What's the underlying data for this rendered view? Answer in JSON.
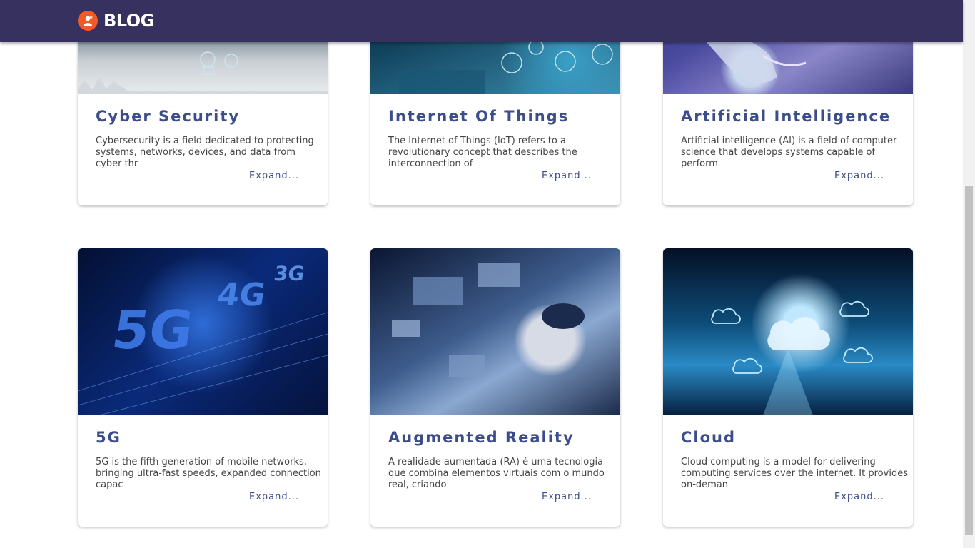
{
  "header": {
    "brand": "BLOG"
  },
  "cards": [
    {
      "title": "Cyber Security",
      "description": "Cybersecurity is a field dedicated to protecting systems, networks, devices, and data from cyber thr",
      "expand": "Expand..."
    },
    {
      "title": "Internet Of Things",
      "description": "The Internet of Things (IoT) refers to a revolutionary concept that describes the interconnection of",
      "expand": "Expand..."
    },
    {
      "title": "Artificial Intelligence",
      "description": "Artificial intelligence (AI) is a field of computer science that develops systems capable of perform",
      "expand": "Expand..."
    },
    {
      "title": "5G",
      "description": "5G is the fifth generation of mobile networks, bringing ultra-fast speeds, expanded connection capac",
      "expand": "Expand..."
    },
    {
      "title": "Augmented Reality",
      "description": "A realidade aumentada (RA) é uma tecnologia que combina elementos virtuais com o mundo real, criando",
      "expand": "Expand..."
    },
    {
      "title": "Cloud",
      "description": "Cloud computing is a model for delivering computing services over the internet. It provides on-deman",
      "expand": "Expand..."
    }
  ],
  "colors": {
    "header_bg": "#36315f",
    "logo": "#f15a24",
    "title": "#3c4d8c"
  }
}
